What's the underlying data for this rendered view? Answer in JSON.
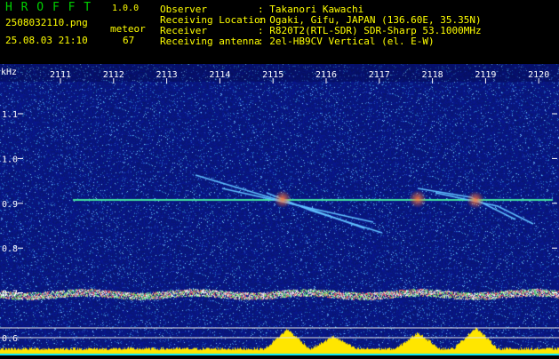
{
  "header": {
    "app_name": "H R O F F T",
    "version": "1.0.0",
    "filename": "2508032110.png",
    "mode_label": "meteor",
    "datetime": "25.08.03 21:10",
    "count": "67",
    "observer_label": "Observer",
    "observer_value": ": Takanori Kawachi",
    "location_label": "Receiving Location",
    "location_value": ": Ogaki, Gifu, JAPAN (136.60E, 35.35N)",
    "receiver_label": "Receiver",
    "receiver_value": ": R820T2(RTL-SDR) SDR-Sharp 53.1000MHz",
    "antenna_label": "Receiving antenna",
    "antenna_value": ": 2el-HB9CV Vertical (el. E-W)"
  },
  "axes": {
    "y_unit": "kHz",
    "y_ticks": [
      "1.1",
      "1.0",
      "0.9",
      "0.8",
      "0.7",
      "0.6"
    ],
    "x_ticks": [
      "2111",
      "2112",
      "2113",
      "2114",
      "2115",
      "2116",
      "2117",
      "2118",
      "2119",
      "2120"
    ]
  },
  "colors": {
    "background": "#000000",
    "header_text": "#ffff00",
    "app_name": "#00d000",
    "axis_text": "#ffffff",
    "spectrogram_base": "#0a1a7a",
    "carrier_line": "#40e0a0",
    "meteor_trace": "#60c0ff"
  }
}
